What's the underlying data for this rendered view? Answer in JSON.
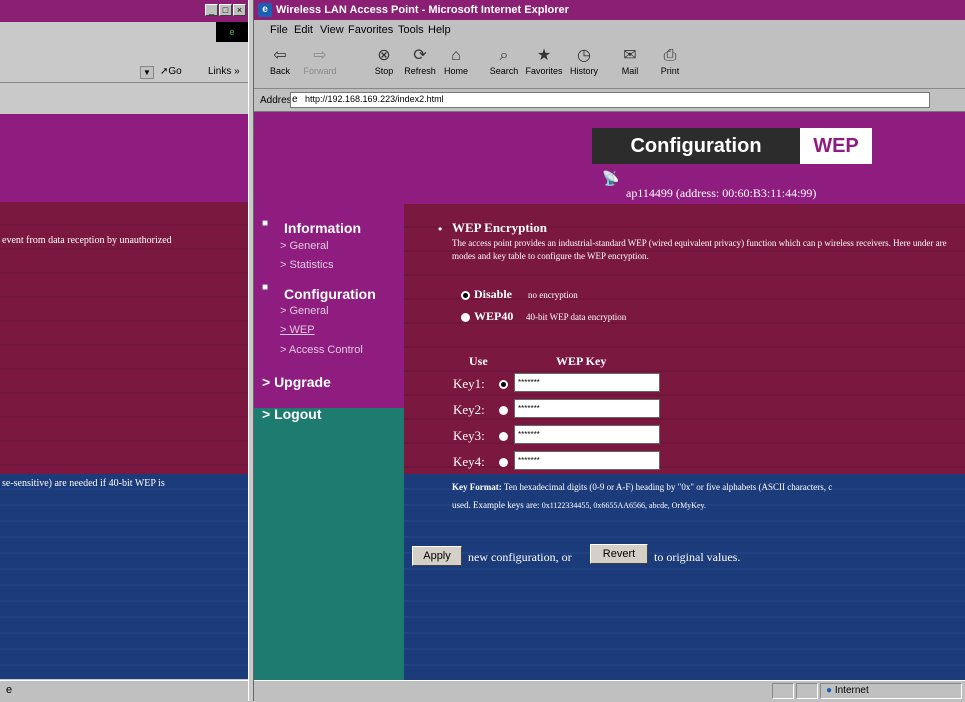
{
  "left_window": {
    "go_label": "Go",
    "links_label": "Links »",
    "text_line1": "event from data reception by unauthorized",
    "text_line2": "se-sensitive) are needed if 40-bit WEP is"
  },
  "window": {
    "title": "Wireless LAN Access Point - Microsoft Internet Explorer"
  },
  "menu": [
    "File",
    "Edit",
    "View",
    "Favorites",
    "Tools",
    "Help"
  ],
  "toolbar": [
    {
      "label": "Back",
      "icon": "back-arrow-icon",
      "glyph": "⇦"
    },
    {
      "label": "Forward",
      "icon": "forward-arrow-icon",
      "glyph": "⇨"
    },
    {
      "label": "Stop",
      "icon": "stop-icon",
      "glyph": "⊗"
    },
    {
      "label": "Refresh",
      "icon": "refresh-icon",
      "glyph": "⟳"
    },
    {
      "label": "Home",
      "icon": "home-icon",
      "glyph": "⌂"
    },
    {
      "label": "Search",
      "icon": "search-icon",
      "glyph": "⌕"
    },
    {
      "label": "Favorites",
      "icon": "favorites-icon",
      "glyph": "★"
    },
    {
      "label": "History",
      "icon": "history-icon",
      "glyph": "◷"
    },
    {
      "label": "Mail",
      "icon": "mail-icon",
      "glyph": "✉"
    },
    {
      "label": "Print",
      "icon": "print-icon",
      "glyph": "⎙"
    }
  ],
  "address": {
    "label": "Address",
    "url": "http://192.168.169.223/index2.html"
  },
  "header": {
    "config_label": "Configuration",
    "wep_label": "WEP",
    "ap_info": "ap114499 (address: 00:60:B3:11:44:99)"
  },
  "nav": {
    "information": "Information",
    "info_general": "> General",
    "info_statistics": "> Statistics",
    "configuration": "Configuration",
    "conf_general": "> General",
    "conf_wep": "> WEP",
    "conf_access": "> Access Control",
    "upgrade": "> Upgrade",
    "logout": "> Logout"
  },
  "wep": {
    "title": "WEP Encryption",
    "description": "The access point provides an industrial-standard WEP (wired equivalent privacy) function which can p wireless receivers. Here under are modes and key table to configure the WEP encryption.",
    "modes": [
      {
        "label": "Disable",
        "desc": "no encryption",
        "selected": true
      },
      {
        "label": "WEP40",
        "desc": "40-bit WEP data encryption",
        "selected": false
      }
    ],
    "col_use": "Use",
    "col_key": "WEP Key",
    "keys": [
      {
        "label": "Key1:",
        "value": "*******",
        "selected": true
      },
      {
        "label": "Key2:",
        "value": "*******",
        "selected": false
      },
      {
        "label": "Key3:",
        "value": "*******",
        "selected": false
      },
      {
        "label": "Key4:",
        "value": "*******",
        "selected": false
      }
    ],
    "key_format_label": "Key Format:",
    "key_format_text": "Ten hexadecimal digits (0-9 or A-F) heading by \"0x\" or five alphabets (ASCII characters, c",
    "example_label": "used. Example keys are:",
    "example_keys": "0x1122334455, 0x6655AA6566, abcde, OrMyKey."
  },
  "actions": {
    "apply_label": "Apply",
    "apply_text": "new configuration, or",
    "revert_label": "Revert",
    "revert_text": "to original values."
  },
  "status": {
    "zone": "Internet"
  }
}
